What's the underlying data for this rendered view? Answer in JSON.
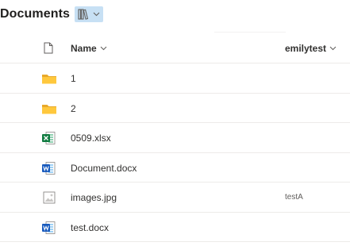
{
  "header": {
    "title": "Documents",
    "view_icon": "library-icon"
  },
  "columns": {
    "type_icon": "file-icon",
    "name_label": "Name",
    "custom_label": "emilytest"
  },
  "rows": [
    {
      "type": "folder",
      "name": "1",
      "custom": ""
    },
    {
      "type": "folder",
      "name": "2",
      "custom": ""
    },
    {
      "type": "xlsx",
      "name": "0509.xlsx",
      "custom": ""
    },
    {
      "type": "docx",
      "name": "Document.docx",
      "custom": ""
    },
    {
      "type": "image",
      "name": "images.jpg",
      "custom": "testA"
    },
    {
      "type": "docx",
      "name": "test.docx",
      "custom": ""
    }
  ],
  "colors": {
    "folder": "#ffc83d",
    "excel": "#107c41",
    "word": "#185abd",
    "view_switch_bg": "#c7e0f4"
  }
}
